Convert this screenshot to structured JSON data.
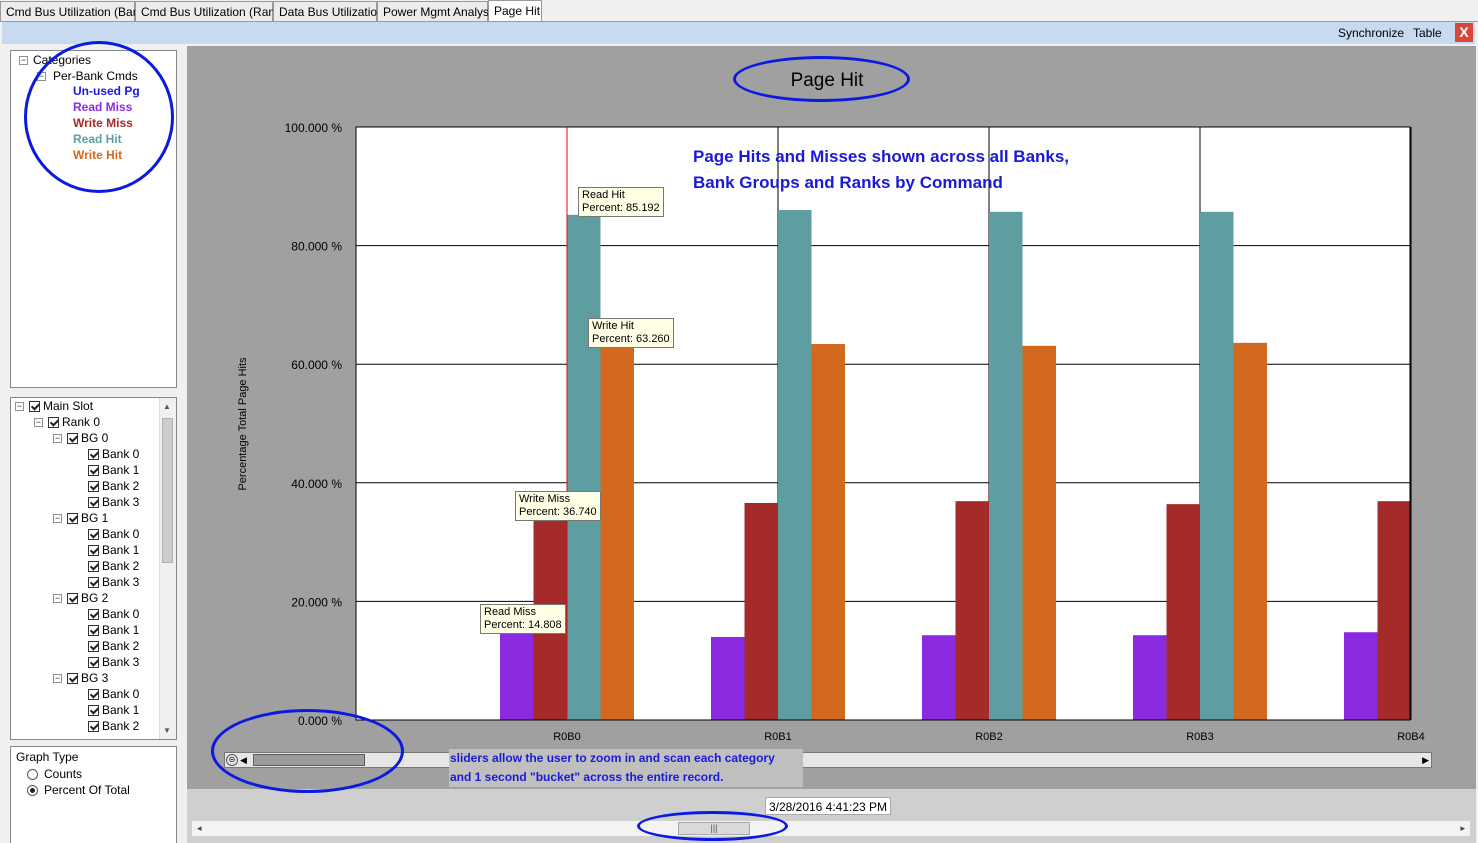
{
  "tabs": [
    {
      "label": "Cmd Bus Utilization (Bank)",
      "active": false
    },
    {
      "label": "Cmd Bus Utilization (Rank)",
      "active": false
    },
    {
      "label": "Data Bus Utilization",
      "active": false
    },
    {
      "label": "Power Mgmt Analysis",
      "active": false
    },
    {
      "label": "Page Hit",
      "active": true
    }
  ],
  "toolbar": {
    "synchronize_label": "Synchronize",
    "table_label": "Table",
    "close_label": "X"
  },
  "categories": {
    "root": "Categories",
    "group": "Per-Bank Cmds",
    "items": [
      {
        "label": "Un-used Pg",
        "color": "#1a1ad6"
      },
      {
        "label": "Read Miss",
        "color": "#8a2be2"
      },
      {
        "label": "Write Miss",
        "color": "#a52a2a"
      },
      {
        "label": "Read Hit",
        "color": "#5f9ea0"
      },
      {
        "label": "Write Hit",
        "color": "#d2691e"
      }
    ]
  },
  "slots": {
    "root": "Main Slot",
    "rank": "Rank 0",
    "groups": [
      {
        "label": "BG 0",
        "banks": [
          "Bank 0",
          "Bank 1",
          "Bank 2",
          "Bank 3"
        ]
      },
      {
        "label": "BG 1",
        "banks": [
          "Bank 0",
          "Bank 1",
          "Bank 2",
          "Bank 3"
        ]
      },
      {
        "label": "BG 2",
        "banks": [
          "Bank 0",
          "Bank 1",
          "Bank 2",
          "Bank 3"
        ]
      },
      {
        "label": "BG 3",
        "banks": [
          "Bank 0",
          "Bank 1",
          "Bank 2"
        ]
      }
    ]
  },
  "graph_type": {
    "title": "Graph Type",
    "options": [
      {
        "label": "Counts",
        "selected": false
      },
      {
        "label": "Percent Of Total",
        "selected": true
      }
    ]
  },
  "annotations": {
    "headline_1": "Page Hits and Misses shown across all Banks,",
    "headline_2": "Bank Groups and Ranks by Command",
    "slider_note_1": "sliders allow the user to zoom in and scan each category",
    "slider_note_2": "and 1 second \"bucket\" across the entire record."
  },
  "tooltips": [
    {
      "name": "Read Hit",
      "text": "Percent: 85.192"
    },
    {
      "name": "Write Hit",
      "text": "Percent: 63.260"
    },
    {
      "name": "Write Miss",
      "text": "Percent: 36.740"
    },
    {
      "name": "Read Miss",
      "text": "Percent: 14.808"
    }
  ],
  "timestamp": "3/28/2016 4:41:23 PM",
  "chart_data": {
    "type": "bar",
    "title": "Page Hit",
    "ylabel": "Percentage Total Page Hits",
    "xlabel": "",
    "ylim": [
      0,
      100
    ],
    "ytick_labels": [
      "0.000 %",
      "20.000 %",
      "40.000 %",
      "60.000 %",
      "80.000 %",
      "100.000 %"
    ],
    "categories": [
      "R0B0",
      "R0B1",
      "R0B2",
      "R0B3",
      "R0B4"
    ],
    "grid": true,
    "series": [
      {
        "name": "Read Miss",
        "color": "#8a2be2",
        "values": [
          14.808,
          14.0,
          14.3,
          14.3,
          14.8
        ]
      },
      {
        "name": "Write Miss",
        "color": "#a52a2a",
        "values": [
          36.74,
          36.6,
          36.9,
          36.4,
          36.9
        ]
      },
      {
        "name": "Read Hit",
        "color": "#5f9ea0",
        "values": [
          85.192,
          86.0,
          85.7,
          85.7,
          null
        ]
      },
      {
        "name": "Write Hit",
        "color": "#d2691e",
        "values": [
          63.26,
          63.4,
          63.1,
          63.6,
          null
        ]
      }
    ]
  }
}
